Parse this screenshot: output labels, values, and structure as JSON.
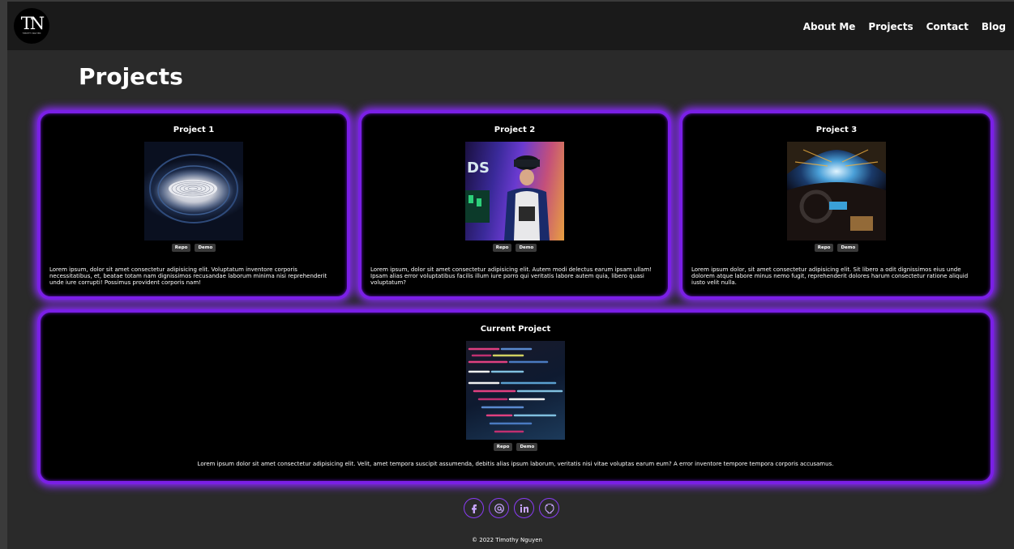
{
  "brand": {
    "logo_mark": "TN",
    "logo_sub": "TIMOTHY NGUYEN"
  },
  "nav": {
    "about": "About Me",
    "projects": "Projects",
    "contact": "Contact",
    "blog": "Blog"
  },
  "page": {
    "title": "Projects"
  },
  "projects": [
    {
      "title": "Project 1",
      "repo_label": "Repo",
      "demo_label": "Demo",
      "description": "Lorem ipsum, dolor sit amet consectetur adipisicing elit. Voluptatum inventore corporis necessitatibus, et, beatae totam nam dignissimos recusandae laborum minima nisi reprehenderit unde iure corrupti! Possimus provident corporis nam!"
    },
    {
      "title": "Project 2",
      "repo_label": "Repo",
      "demo_label": "Demo",
      "description": "Lorem ipsum, dolor sit amet consectetur adipisicing elit. Autem modi delectus earum ipsam ullam! Ipsam alias error voluptatibus facilis illum iure porro qui veritatis labore autem quia, libero quasi voluptatum?"
    },
    {
      "title": "Project 3",
      "repo_label": "Repo",
      "demo_label": "Demo",
      "description": "Lorem ipsum dolor, sit amet consectetur adipisicing elit. Sit libero a odit dignissimos eius unde dolorem atque labore minus nemo fugit, reprehenderit dolores harum consectetur ratione aliquid iusto velit nulla."
    }
  ],
  "current_project": {
    "title": "Current Project",
    "repo_label": "Repo",
    "demo_label": "Demo",
    "description": "Lorem ipsum dolor sit amet consectetur adipisicing elit. Velit, amet tempora suscipit assumenda, debitis alias ipsum laborum, veritatis nisi vitae voluptas earum eum? A error inventore tempore tempora corporis accusamus."
  },
  "socials": [
    {
      "icon": "facebook-icon"
    },
    {
      "icon": "email-icon"
    },
    {
      "icon": "linkedin-icon"
    },
    {
      "icon": "github-icon"
    }
  ],
  "footer": {
    "copyright": "© 2022 Timothy Nguyen"
  },
  "colors": {
    "accent": "#7a1fe6",
    "glow": "#8b2cff",
    "background": "#2a2a2a",
    "navbar": "#1a1a1a"
  }
}
